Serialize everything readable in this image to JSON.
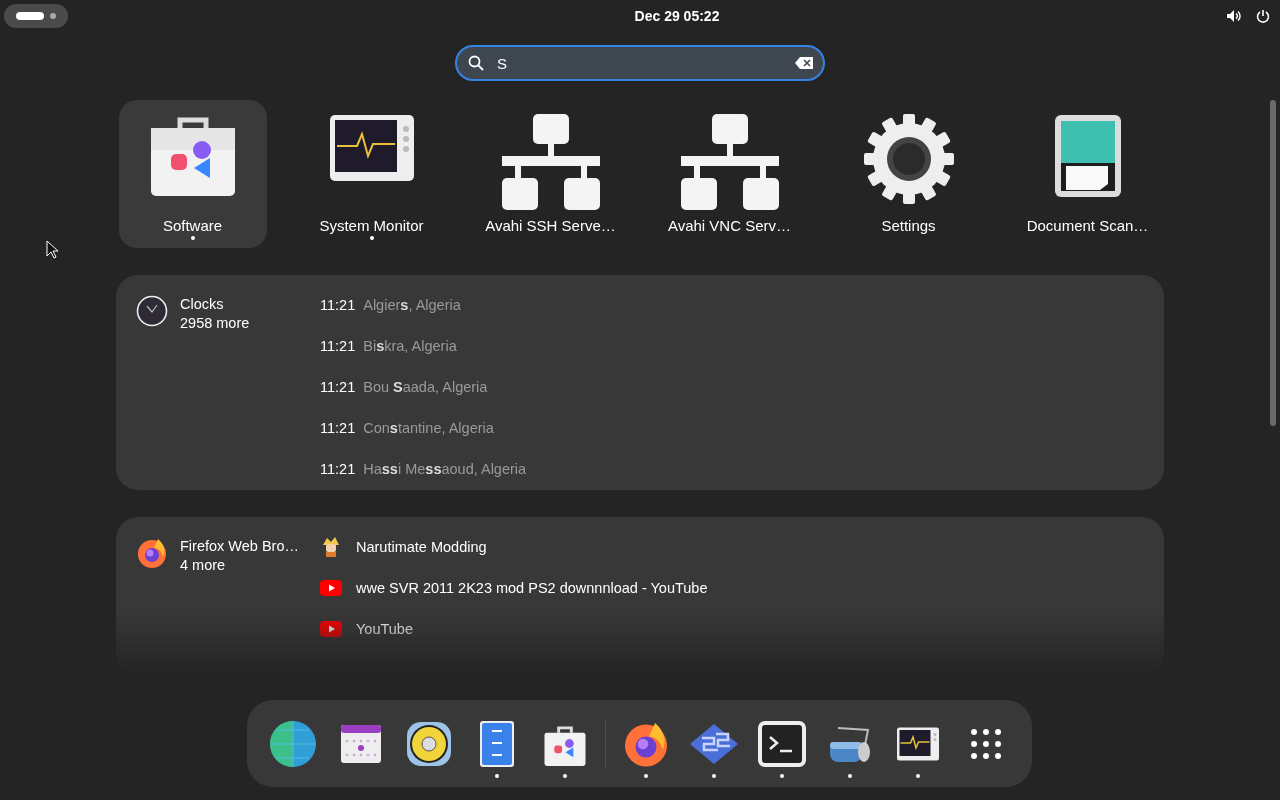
{
  "top_bar": {
    "clock": "Dec 29  05:22"
  },
  "search": {
    "value": "S"
  },
  "apps": [
    {
      "name": "Software",
      "kind": "software",
      "selected": true,
      "running": true
    },
    {
      "name": "System Monitor",
      "kind": "monitor",
      "selected": false,
      "running": true
    },
    {
      "name": "Avahi SSH Serve…",
      "kind": "network",
      "selected": false,
      "running": false
    },
    {
      "name": "Avahi VNC Serv…",
      "kind": "network",
      "selected": false,
      "running": false
    },
    {
      "name": "Settings",
      "kind": "gear",
      "selected": false,
      "running": false
    },
    {
      "name": "Document Scan…",
      "kind": "scanner",
      "selected": false,
      "running": false
    }
  ],
  "providers": [
    {
      "kind": "clocks",
      "name": "Clocks",
      "more": "2958 more",
      "results": [
        {
          "time": "11:21",
          "title": "Algier**s**, Algeria"
        },
        {
          "time": "11:21",
          "title": "Bi**s**kra, Algeria"
        },
        {
          "time": "11:21",
          "title": "Bou **S**aada, Algeria"
        },
        {
          "time": "11:21",
          "title": "Con**s**tantine, Algeria"
        },
        {
          "time": "11:21",
          "title": "Ha**ss**i Me**ss**aoud, Algeria"
        }
      ]
    },
    {
      "kind": "browser",
      "name": "Firefox Web Bro…",
      "more": "4 more",
      "results": [
        {
          "kind": "favicon",
          "title": "Narutimate Modding"
        },
        {
          "kind": "video",
          "title": "wwe SVR 2011 2K23 mod PS2 downnnload - YouTube"
        },
        {
          "kind": "video",
          "title": "YouTube"
        }
      ]
    }
  ],
  "dock": {
    "favorites": [
      {
        "kind": "globe",
        "running": false
      },
      {
        "kind": "calendar",
        "running": false
      },
      {
        "kind": "speaker",
        "running": false
      },
      {
        "kind": "files",
        "running": true
      },
      {
        "kind": "software",
        "running": true
      }
    ],
    "others": [
      {
        "kind": "firefox",
        "running": true
      },
      {
        "kind": "emulator",
        "running": true
      },
      {
        "kind": "terminal",
        "running": true
      },
      {
        "kind": "scanner-roller",
        "running": true
      },
      {
        "kind": "monitor",
        "running": true
      }
    ]
  }
}
